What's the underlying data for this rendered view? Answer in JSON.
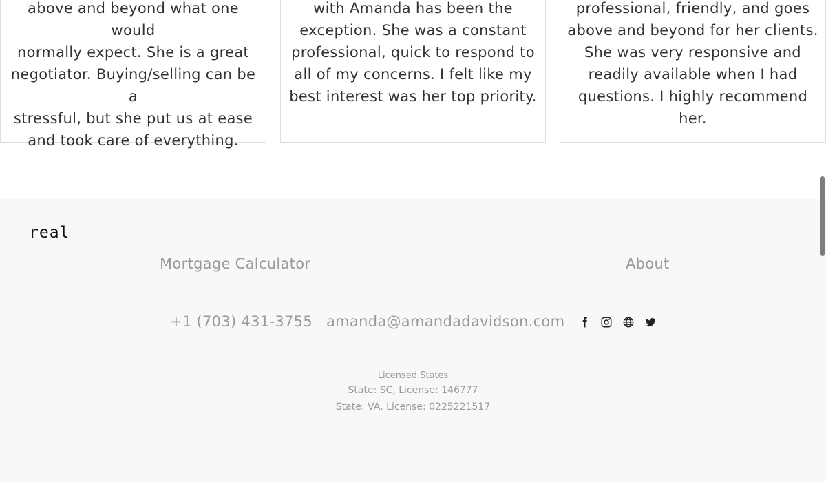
{
  "testimonials": [
    {
      "lines": [
        "above and beyond what one would",
        "normally expect. She is a great",
        "negotiator. Buying/selling can be a",
        "stressful, but she put us at ease",
        "and took care of everything."
      ]
    },
    {
      "lines": [
        "with Amanda has been the",
        "exception. She was a constant",
        "professional, quick to respond to",
        "all of my concerns. I felt like my",
        "best interest was her top priority."
      ]
    },
    {
      "lines": [
        "professional, friendly, and goes",
        "above and beyond for her clients.",
        "She was very responsive and",
        "readily available when I had",
        "questions. I highly recommend",
        "her."
      ]
    }
  ],
  "footer": {
    "logo": "real",
    "links": {
      "mortgage": "Mortgage Calculator",
      "about": "About"
    },
    "phone": "+1 (703) 431-3755",
    "email": "amanda@amandadavidson.com",
    "social_icons": [
      "facebook-icon",
      "instagram-icon",
      "globe-icon",
      "twitter-icon"
    ],
    "licenses": {
      "title": "Licensed States",
      "line1": "State: SC, License: 146777",
      "line2": "State: VA, License: 0225221517"
    }
  }
}
